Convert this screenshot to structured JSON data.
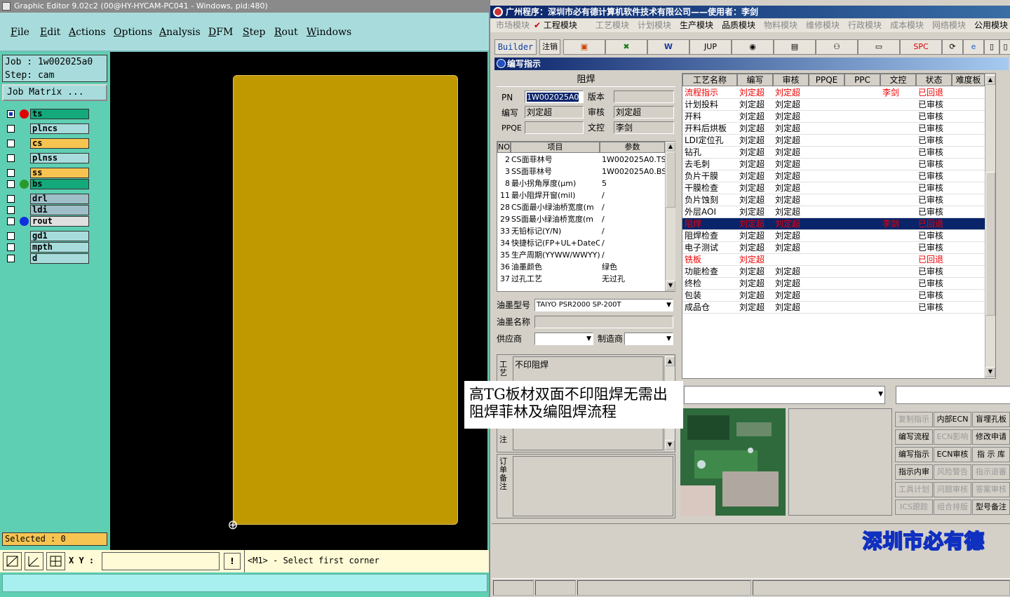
{
  "left_app": {
    "title": "Graphic Editor 9.02c2 (00@HY-HYCAM-PC041 - Windows, pid:480)",
    "menu": [
      "File",
      "Edit",
      "Actions",
      "Options",
      "Analysis",
      "DFM",
      "Step",
      "Rout",
      "Windows"
    ],
    "job_line": "Job : 1w002025a0",
    "step_line": "Step: cam",
    "job_matrix": "Job Matrix ...",
    "layers": [
      {
        "name": "ts",
        "color": "#13a97b",
        "dot": "#e00000",
        "checked": true
      },
      {
        "name": "plncs",
        "color": "#a8dcdc",
        "dot": "",
        "checked": false
      },
      {
        "name": "cs",
        "color": "#f7c451",
        "dot": "",
        "checked": false
      },
      {
        "name": "plnss",
        "color": "#a8dcdc",
        "dot": "",
        "checked": false
      },
      {
        "name": "ss",
        "color": "#f7c451",
        "dot": "",
        "checked": false
      },
      {
        "name": "bs",
        "color": "#13a97b",
        "dot": "#2a9a2a",
        "checked": false
      },
      {
        "name": "drl",
        "color": "#9fbfc8",
        "dot": "",
        "checked": false
      },
      {
        "name": "ldi",
        "color": "#9fbfc8",
        "dot": "",
        "checked": false
      },
      {
        "name": "rout",
        "color": "#e0e0e0",
        "dot": "#1030e0",
        "checked": false
      },
      {
        "name": "gd1",
        "color": "#a8dcdc",
        "dot": "",
        "checked": false
      },
      {
        "name": "mpth",
        "color": "#a8dcdc",
        "dot": "",
        "checked": false
      },
      {
        "name": "d",
        "color": "#a8dcdc",
        "dot": "",
        "checked": false
      }
    ],
    "selected": "Selected : 0",
    "xy_label": "X Y :",
    "prompt": "<M1> - Select first corner",
    "board_color": "#c09800"
  },
  "right_app": {
    "title": "广州程序：深圳市必有德计算机软件技术有限公司——使用者：李剑",
    "modules": [
      "市场模块",
      "工程模块",
      "工艺模块",
      "计划模块",
      "生产模块",
      "品质模块",
      "物料模块",
      "维修模块",
      "行政模块",
      "成本模块",
      "网络模块",
      "公用模块"
    ],
    "toolbar": {
      "builder": "Builder",
      "logout": "注销",
      "jup": "JUP",
      "spc": "SPC"
    },
    "window_title": "编写指示",
    "section_title": "阻焊",
    "form": {
      "pn_label": "PN",
      "pn_value": "1W002025A0",
      "version_label": "版本",
      "version_value": "",
      "writer_label": "编写",
      "writer_value": "刘定超",
      "review_label": "审核",
      "review_value": "刘定超",
      "ppqe_label": "PPQE",
      "ppqe_value": "",
      "doc_label": "文控",
      "doc_value": "李剑"
    },
    "param_headers": [
      "NO",
      "项目",
      "参数"
    ],
    "params": [
      {
        "no": "2",
        "item": "CS面菲林号",
        "value": "1W002025A0.TS"
      },
      {
        "no": "3",
        "item": "SS面菲林号",
        "value": "1W002025A0.BS"
      },
      {
        "no": "8",
        "item": "最小拐角厚度(μm)",
        "value": "5"
      },
      {
        "no": "11",
        "item": "最小阻焊开窗(mil)",
        "value": "/"
      },
      {
        "no": "28",
        "item": "CS面最小绿油桥宽度(m",
        "value": "/"
      },
      {
        "no": "29",
        "item": "SS面最小绿油桥宽度(m",
        "value": "/"
      },
      {
        "no": "33",
        "item": "无铅标记(Y/N)",
        "value": "/"
      },
      {
        "no": "34",
        "item": "快捷标记(FP+UL+DateCo",
        "value": "/"
      },
      {
        "no": "35",
        "item": "生产周期(YYWW/WWYY)",
        "value": "/"
      },
      {
        "no": "36",
        "item": "油墨颜色",
        "value": "绿色"
      },
      {
        "no": "37",
        "item": "过孔工艺",
        "value": "无过孔"
      }
    ],
    "ink_model_label": "油墨型号",
    "ink_model_value": "TAIYO  PSR2000 SP-200T",
    "ink_name_label": "油墨名称",
    "ink_name_value": "",
    "supplier_label": "供应商",
    "supplier_value": "",
    "maker_label": "制造商",
    "maker_value": "",
    "process_note_label": "工艺",
    "process_note_value": "不印阻焊",
    "note_label": "注",
    "order_note_label": "订单备注",
    "grid_headers": [
      "工艺名称",
      "编写",
      "审核",
      "PPQE",
      "PPC",
      "文控",
      "状态",
      "难度板"
    ],
    "grid_rows": [
      {
        "name": "流程指示",
        "w": "刘定超",
        "r": "刘定超",
        "doc": "李剑",
        "s": "已回退",
        "style": "red"
      },
      {
        "name": "计划投料",
        "w": "刘定超",
        "r": "刘定超",
        "doc": "",
        "s": "已审核",
        "style": ""
      },
      {
        "name": "开料",
        "w": "刘定超",
        "r": "刘定超",
        "doc": "",
        "s": "已审核",
        "style": ""
      },
      {
        "name": "开料后烘板",
        "w": "刘定超",
        "r": "刘定超",
        "doc": "",
        "s": "已审核",
        "style": ""
      },
      {
        "name": "LDI定位孔",
        "w": "刘定超",
        "r": "刘定超",
        "doc": "",
        "s": "已审核",
        "style": ""
      },
      {
        "name": "钻孔",
        "w": "刘定超",
        "r": "刘定超",
        "doc": "",
        "s": "已审核",
        "style": ""
      },
      {
        "name": "去毛刺",
        "w": "刘定超",
        "r": "刘定超",
        "doc": "",
        "s": "已审核",
        "style": ""
      },
      {
        "name": "负片干膜",
        "w": "刘定超",
        "r": "刘定超",
        "doc": "",
        "s": "已审核",
        "style": ""
      },
      {
        "name": "干膜检查",
        "w": "刘定超",
        "r": "刘定超",
        "doc": "",
        "s": "已审核",
        "style": ""
      },
      {
        "name": "负片蚀刻",
        "w": "刘定超",
        "r": "刘定超",
        "doc": "",
        "s": "已审核",
        "style": ""
      },
      {
        "name": "外层AOI",
        "w": "刘定超",
        "r": "刘定超",
        "doc": "",
        "s": "已审核",
        "style": ""
      },
      {
        "name": "阻焊",
        "w": "刘定超",
        "r": "刘定超",
        "doc": "李剑",
        "s": "已回退",
        "style": "sel"
      },
      {
        "name": "阻焊检查",
        "w": "刘定超",
        "r": "刘定超",
        "doc": "",
        "s": "已审核",
        "style": ""
      },
      {
        "name": "电子测试",
        "w": "刘定超",
        "r": "刘定超",
        "doc": "",
        "s": "已审核",
        "style": ""
      },
      {
        "name": "铣板",
        "w": "刘定超",
        "r": "",
        "doc": "",
        "s": "已回退",
        "style": "red"
      },
      {
        "name": "功能检查",
        "w": "刘定超",
        "r": "刘定超",
        "doc": "",
        "s": "已审核",
        "style": ""
      },
      {
        "name": "终检",
        "w": "刘定超",
        "r": "刘定超",
        "doc": "",
        "s": "已审核",
        "style": ""
      },
      {
        "name": "包装",
        "w": "刘定超",
        "r": "刘定超",
        "doc": "",
        "s": "已审核",
        "style": ""
      },
      {
        "name": "成品仓",
        "w": "刘定超",
        "r": "刘定超",
        "doc": "",
        "s": "已审核",
        "style": ""
      }
    ],
    "side_buttons": [
      {
        "label": "复制指示",
        "dis": true
      },
      {
        "label": "内部ECN",
        "dis": false
      },
      {
        "label": "盲埋孔板",
        "dis": false
      },
      {
        "label": "编写流程",
        "dis": false
      },
      {
        "label": "ECN影响",
        "dis": true
      },
      {
        "label": "修改申请",
        "dis": false
      },
      {
        "label": "编写指示",
        "dis": false
      },
      {
        "label": "ECN审核",
        "dis": false
      },
      {
        "label": "指 示 库",
        "dis": false
      },
      {
        "label": "指示内审",
        "dis": false
      },
      {
        "label": "风险警告",
        "dis": true
      },
      {
        "label": "指示退審",
        "dis": true
      },
      {
        "label": "工具计划",
        "dis": true
      },
      {
        "label": "问题审核",
        "dis": true
      },
      {
        "label": "答案审核",
        "dis": true
      },
      {
        "label": "ICS跟踪",
        "dis": true
      },
      {
        "label": "组合排版",
        "dis": true
      },
      {
        "label": "型号备注",
        "dis": false
      }
    ],
    "banner": "深圳市必有德"
  },
  "overlay_note": "高TG板材双面不印阻焊无需出阻焊菲林及编阻焊流程"
}
